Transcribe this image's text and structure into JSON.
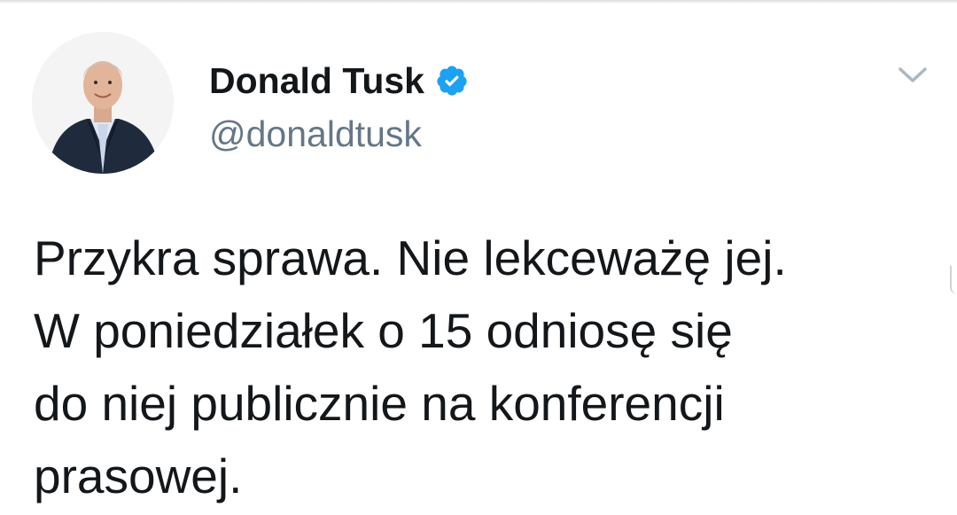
{
  "tweet": {
    "author": {
      "display_name": "Donald Tusk",
      "handle": "@donaldtusk",
      "verified": true,
      "avatar_icon": "profile-photo"
    },
    "text": "Przykra sprawa. Nie lekceważę jej.\nW poniedziałek o 15 odniosę się\ndo niej publicznie na konferencji\nprasowej.",
    "menu_icon": "chevron-down-icon"
  },
  "colors": {
    "verified_blue": "#1da1f2",
    "handle_gray": "#657786",
    "text_dark": "#14171a",
    "chevron_gray": "#aab8c2"
  }
}
